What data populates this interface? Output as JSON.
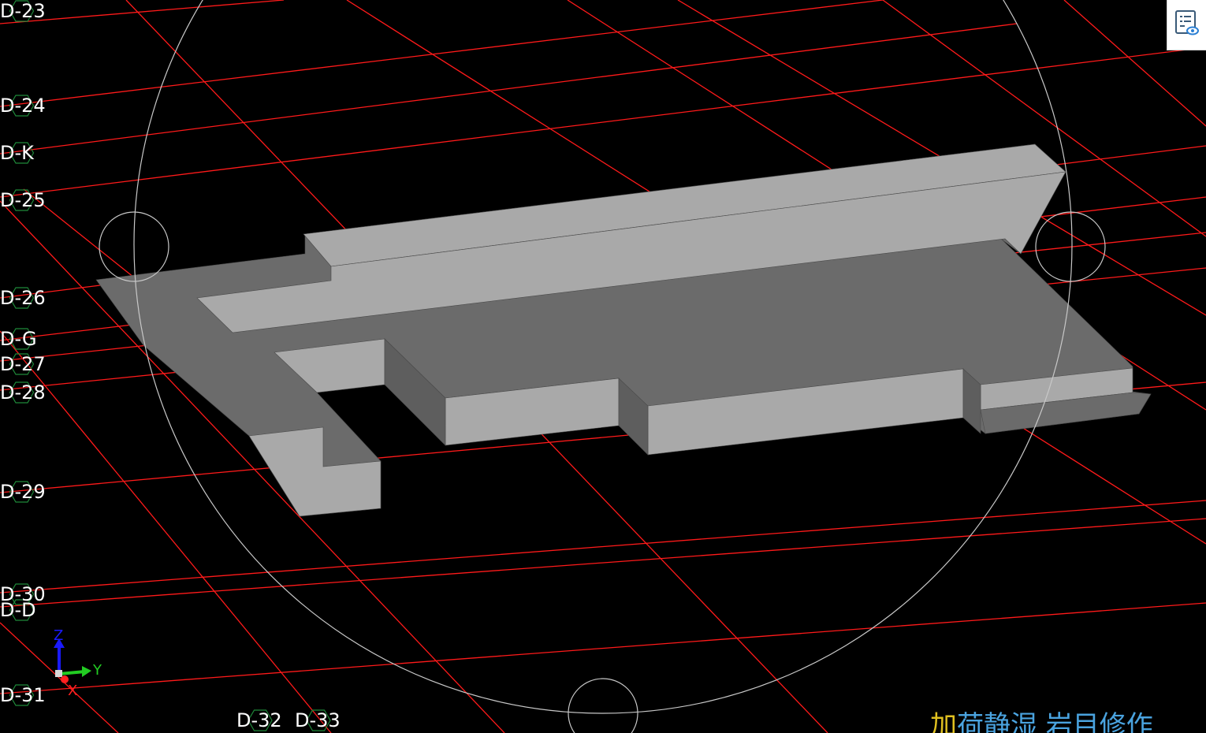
{
  "viewport": {
    "background_color": "#000000",
    "grid_color": "#ff1a1a",
    "model_colors": {
      "light_face": "#a9a9a9",
      "dark_face": "#6b6b6b"
    },
    "navigation_circle_color": "#c8c8c8",
    "grid_axis_labels": [
      {
        "label": "D-23",
        "kind": "row"
      },
      {
        "label": "D-24",
        "kind": "row"
      },
      {
        "label": "D-K",
        "kind": "row"
      },
      {
        "label": "D-25",
        "kind": "row"
      },
      {
        "label": "D-26",
        "kind": "row"
      },
      {
        "label": "D-G",
        "kind": "row"
      },
      {
        "label": "D-27",
        "kind": "row"
      },
      {
        "label": "D-28",
        "kind": "row"
      },
      {
        "label": "D-29",
        "kind": "row"
      },
      {
        "label": "D-30",
        "kind": "row"
      },
      {
        "label": "D-D",
        "kind": "row"
      },
      {
        "label": "D-31",
        "kind": "row"
      },
      {
        "label": "D-32",
        "kind": "column"
      },
      {
        "label": "D-33",
        "kind": "column"
      }
    ]
  },
  "axis_triad": {
    "z_label": "Z",
    "y_label": "Y",
    "x_label": "X",
    "z_color": "#1a1aff",
    "y_color": "#22cc22",
    "x_color": "#ff2020"
  },
  "properties_panel_button": {
    "icon": "document-view-icon"
  },
  "status_text": {
    "first_char": "加",
    "rest": "荷静湿 岩目修作"
  }
}
